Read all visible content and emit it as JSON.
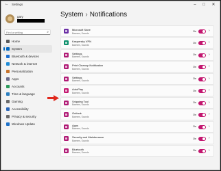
{
  "window": {
    "title": "Settings",
    "back_icon": "←",
    "minimize": "–",
    "maximize": "□",
    "close": "✕"
  },
  "user": {
    "name": "gary"
  },
  "search": {
    "placeholder": "Find a setting",
    "icon": "⌕"
  },
  "sidebar": {
    "items": [
      {
        "label": "Home",
        "icon_color": "#5a5a5a",
        "active": false
      },
      {
        "label": "System",
        "icon_color": "#0067c0",
        "active": true
      },
      {
        "label": "Bluetooth & devices",
        "icon_color": "#1b6fd1",
        "active": false
      },
      {
        "label": "Network & internet",
        "icon_color": "#1e8bd6",
        "active": false
      },
      {
        "label": "Personalization",
        "icon_color": "#c7742d",
        "active": false
      },
      {
        "label": "Apps",
        "icon_color": "#6b6b8a",
        "active": false
      },
      {
        "label": "Accounts",
        "icon_color": "#2c9b5c",
        "active": false
      },
      {
        "label": "Time & language",
        "icon_color": "#2b7fc0",
        "active": false
      },
      {
        "label": "Gaming",
        "icon_color": "#6b6b6b",
        "active": false
      },
      {
        "label": "Accessibility",
        "icon_color": "#2a66b8",
        "active": false
      },
      {
        "label": "Privacy & security",
        "icon_color": "#6b6b6b",
        "active": false
      },
      {
        "label": "Windows Update",
        "icon_color": "#1f72c9",
        "active": false
      }
    ]
  },
  "header": {
    "parent": "System",
    "separator": "›",
    "title": "Notifications"
  },
  "apps": [
    {
      "name": "Microsoft Store",
      "sub": "Banners, Sounds",
      "status": "On",
      "icon_color": "#6b2fa5"
    },
    {
      "name": "Kaspersky VPN",
      "sub": "Banners, Sounds",
      "status": "On",
      "icon_color": "#0c8f6b"
    },
    {
      "name": "Settings",
      "sub": "Banners, Sounds",
      "status": "On",
      "icon_color": "#b01a75"
    },
    {
      "name": "Print Cleanup Notification",
      "sub": "Banners, Sounds",
      "status": "On",
      "icon_color": "#b01a75"
    },
    {
      "name": "Settings",
      "sub": "Banners, Sounds",
      "status": "On",
      "icon_color": "#b01a75"
    },
    {
      "name": "AutoPlay",
      "sub": "Banners, Sounds",
      "status": "On",
      "icon_color": "#c3166f"
    },
    {
      "name": "Snipping Tool",
      "sub": "Banners, Sounds",
      "status": "On",
      "icon_color": "#b01a75"
    },
    {
      "name": "Outlook",
      "sub": "Banners, Sounds",
      "status": "On",
      "icon_color": "#b01a75"
    },
    {
      "name": "Apps",
      "sub": "Banners, Sounds",
      "status": "On",
      "icon_color": "#b01a75"
    },
    {
      "name": "Security and Maintenance",
      "sub": "Banners, Sounds",
      "status": "On",
      "icon_color": "#b01a75"
    },
    {
      "name": "Bluetooth",
      "sub": "Banners, Sounds",
      "status": "On",
      "icon_color": "#b01a75"
    }
  ],
  "colors": {
    "accent": "#c3166f",
    "annotation_arrow": "#e0281c"
  }
}
